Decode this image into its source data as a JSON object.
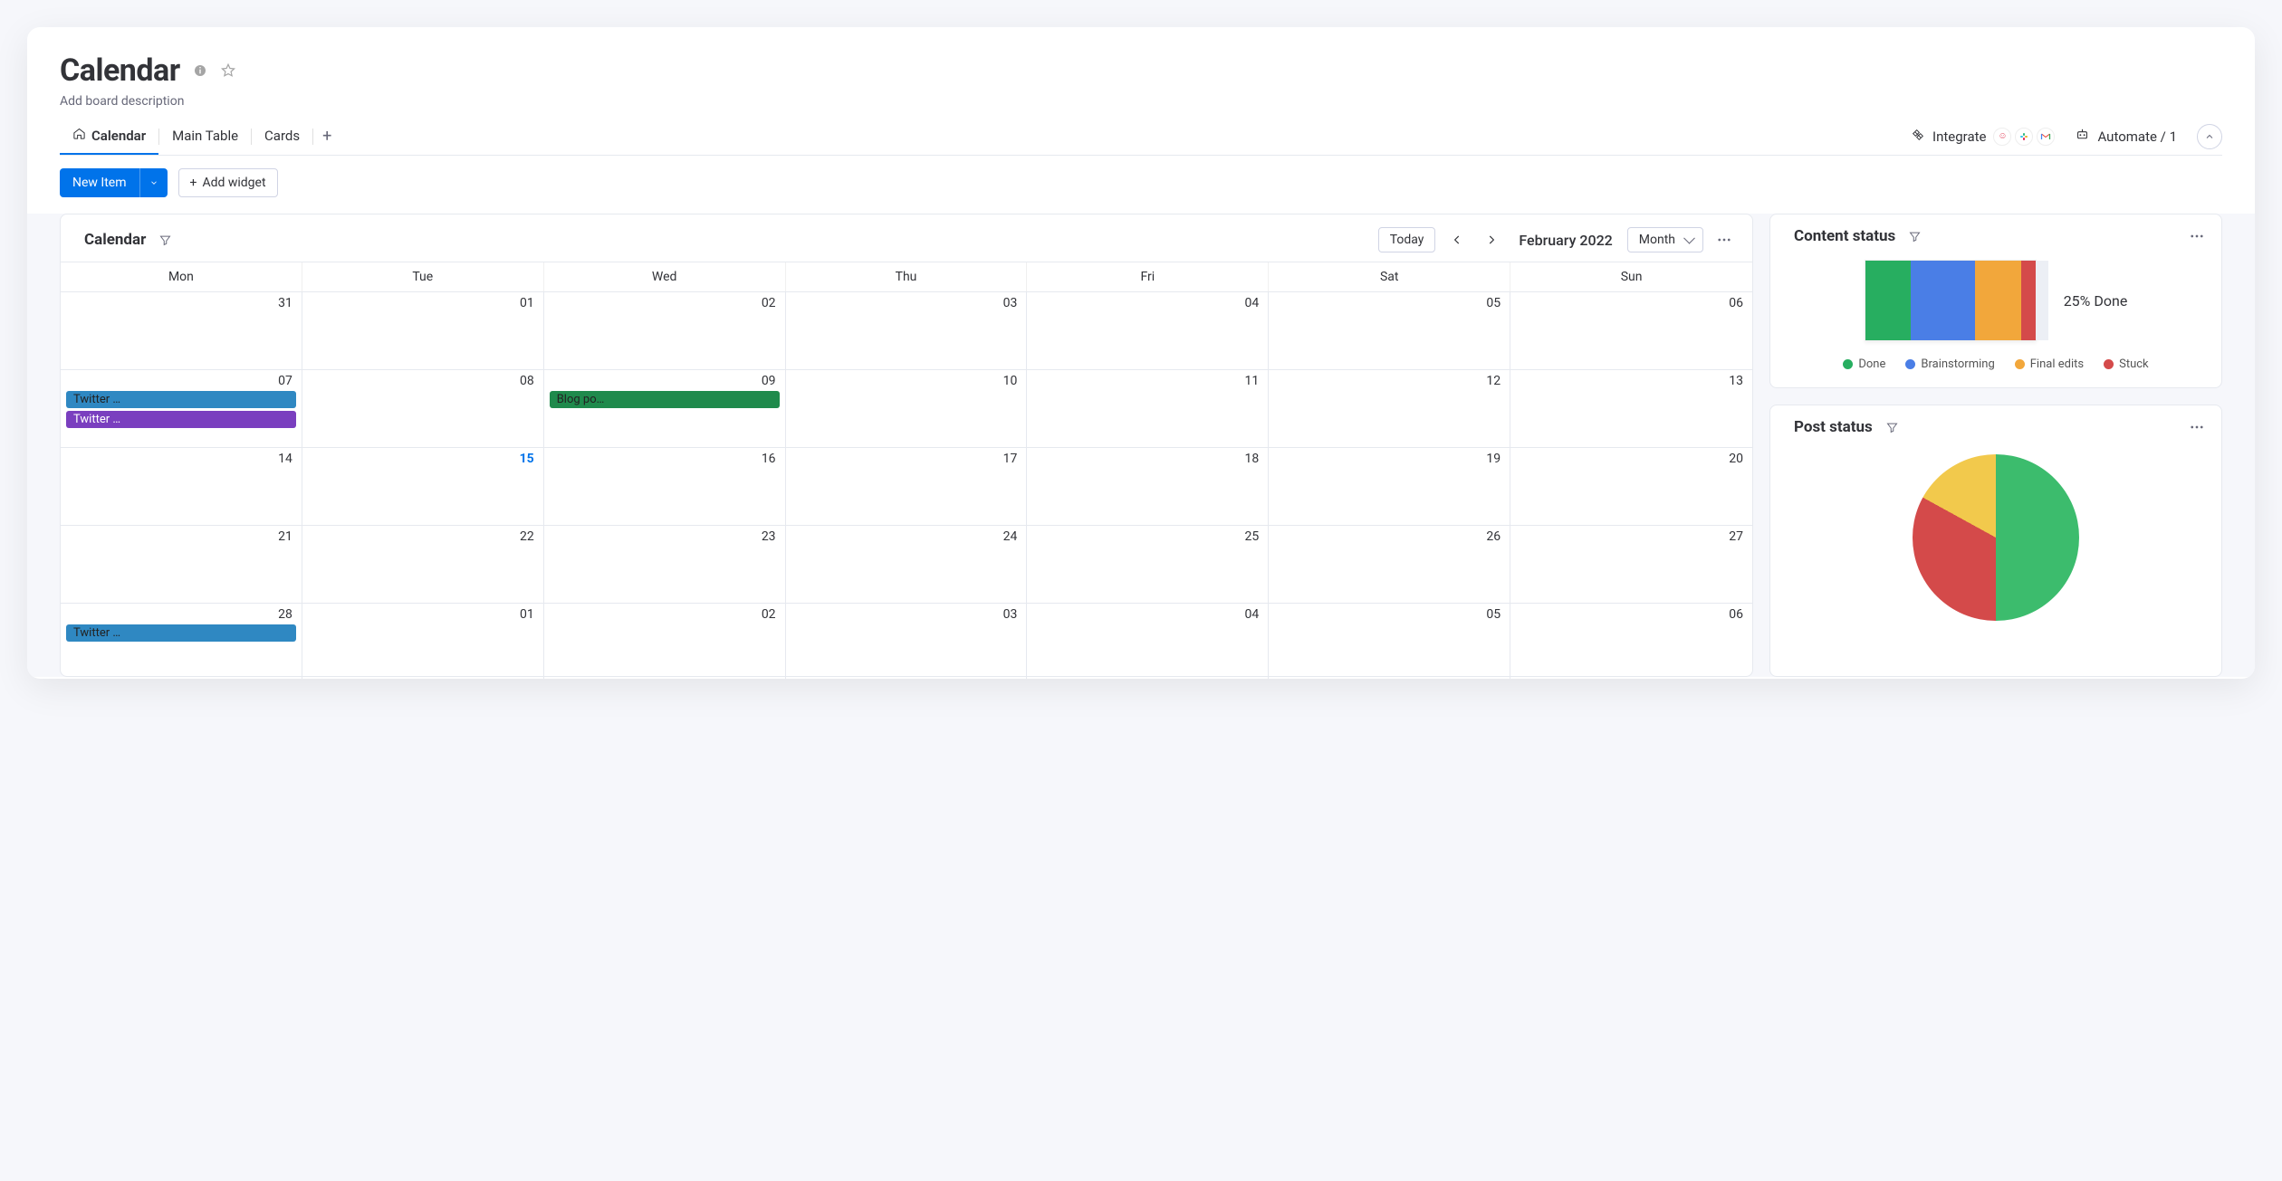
{
  "header": {
    "title": "Calendar",
    "description_placeholder": "Add board description"
  },
  "tabs": [
    {
      "label": "Calendar",
      "active": true,
      "icon": "home"
    },
    {
      "label": "Main Table",
      "active": false
    },
    {
      "label": "Cards",
      "active": false
    }
  ],
  "toolbar": {
    "integrate_label": "Integrate",
    "automate_label": "Automate / 1",
    "new_item_label": "New Item",
    "add_widget_label": "Add widget"
  },
  "calendar": {
    "title": "Calendar",
    "today_label": "Today",
    "month_label": "February 2022",
    "view_label": "Month",
    "weekdays": [
      "Mon",
      "Tue",
      "Wed",
      "Thu",
      "Fri",
      "Sat",
      "Sun"
    ],
    "today_day": "15",
    "weeks": [
      [
        {
          "num": "31",
          "events": []
        },
        {
          "num": "01",
          "events": []
        },
        {
          "num": "02",
          "events": []
        },
        {
          "num": "03",
          "events": []
        },
        {
          "num": "04",
          "events": []
        },
        {
          "num": "05",
          "events": []
        },
        {
          "num": "06",
          "events": []
        }
      ],
      [
        {
          "num": "07",
          "events": [
            {
              "label": "Twitter …",
              "color": "#2f88c2",
              "dark": true
            },
            {
              "label": "Twitter …",
              "color": "#7a3fbf"
            }
          ]
        },
        {
          "num": "08",
          "events": []
        },
        {
          "num": "09",
          "events": [
            {
              "label": "Blog po…",
              "color": "#1f8a4c",
              "dark": true
            }
          ]
        },
        {
          "num": "10",
          "events": []
        },
        {
          "num": "11",
          "events": []
        },
        {
          "num": "12",
          "events": []
        },
        {
          "num": "13",
          "events": []
        }
      ],
      [
        {
          "num": "14",
          "events": []
        },
        {
          "num": "15",
          "events": []
        },
        {
          "num": "16",
          "events": []
        },
        {
          "num": "17",
          "events": []
        },
        {
          "num": "18",
          "events": []
        },
        {
          "num": "19",
          "events": []
        },
        {
          "num": "20",
          "events": []
        }
      ],
      [
        {
          "num": "21",
          "events": []
        },
        {
          "num": "22",
          "events": []
        },
        {
          "num": "23",
          "events": []
        },
        {
          "num": "24",
          "events": []
        },
        {
          "num": "25",
          "events": []
        },
        {
          "num": "26",
          "events": []
        },
        {
          "num": "27",
          "events": []
        }
      ],
      [
        {
          "num": "28",
          "events": [
            {
              "label": "Twitter …",
              "color": "#2f88c2",
              "dark": true
            }
          ]
        },
        {
          "num": "01",
          "events": []
        },
        {
          "num": "02",
          "events": []
        },
        {
          "num": "03",
          "events": []
        },
        {
          "num": "04",
          "events": []
        },
        {
          "num": "05",
          "events": []
        },
        {
          "num": "06",
          "events": []
        }
      ]
    ]
  },
  "content_status": {
    "title": "Content status",
    "done_text": "25% Done",
    "legend": [
      {
        "label": "Done",
        "color": "#27ae60"
      },
      {
        "label": "Brainstorming",
        "color": "#4a7ee6"
      },
      {
        "label": "Final edits",
        "color": "#f2a73b"
      },
      {
        "label": "Stuck",
        "color": "#d44a4a"
      }
    ]
  },
  "post_status": {
    "title": "Post status"
  },
  "chart_data": [
    {
      "type": "bar",
      "title": "Content status",
      "orientation": "stacked-horizontal",
      "series": [
        {
          "name": "Done",
          "values": [
            25
          ],
          "color": "#27ae60"
        },
        {
          "name": "Brainstorming",
          "values": [
            35
          ],
          "color": "#4a7ee6"
        },
        {
          "name": "Final edits",
          "values": [
            25
          ],
          "color": "#f2a73b"
        },
        {
          "name": "Stuck",
          "values": [
            8
          ],
          "color": "#d44a4a"
        }
      ],
      "annotation": "25% Done"
    },
    {
      "type": "pie",
      "title": "Post status",
      "series": [
        {
          "name": "Green",
          "values": [
            50
          ],
          "color": "#3cbc6d"
        },
        {
          "name": "Red",
          "values": [
            33
          ],
          "color": "#d44a4a"
        },
        {
          "name": "Yellow",
          "values": [
            17
          ],
          "color": "#f2c94c"
        }
      ]
    }
  ]
}
